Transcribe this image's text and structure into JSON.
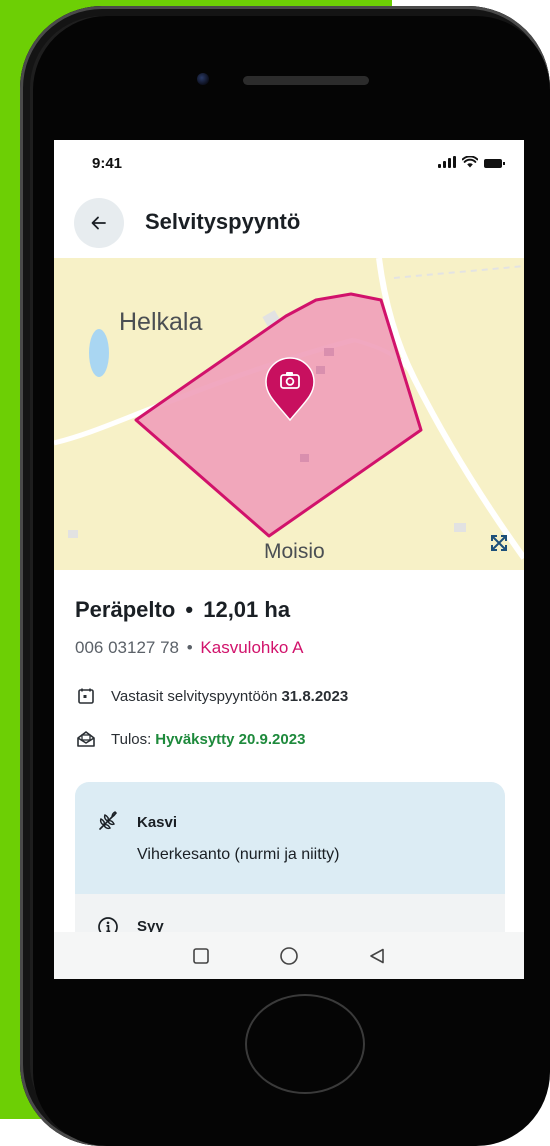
{
  "status_bar": {
    "time": "9:41"
  },
  "app_bar": {
    "title": "Selvityspyyntö",
    "back_icon": "arrow-left-icon"
  },
  "map": {
    "labels": {
      "place_1": "Helkala",
      "place_2": "Moisio"
    },
    "marker_icon": "camera-icon",
    "expand_icon": "expand-icon",
    "colors": {
      "land": "#f7f1c7",
      "parcel_fill": "#ef9fb9",
      "parcel_stroke": "#d1126b",
      "marker": "#c8105f",
      "water": "#a9d6f2"
    }
  },
  "field": {
    "name": "Peräpelto",
    "separator": "•",
    "area": "12,01 ha",
    "id": "006 03127 78",
    "block_link": "Kasvulohko A"
  },
  "response": {
    "text": "Vastasit selvityspyyntöön",
    "date": "31.8.2023",
    "icon": "calendar-icon"
  },
  "result": {
    "prefix": "Tulos:",
    "value": "Hyväksytty 20.9.2023",
    "icon": "inbox-icon"
  },
  "card": {
    "label": "Kasvi",
    "value": "Viherkesanto (nurmi ja niitty)",
    "icon": "wheat-icon"
  },
  "card2": {
    "label": "Syy",
    "icon": "info-icon"
  },
  "nav": {
    "recents_icon": "square-icon",
    "home_icon": "circle-icon",
    "back_icon": "triangle-back-icon"
  },
  "theme": {
    "accent": "#d1126b",
    "success": "#1e8a3c",
    "card_bg": "#dcecf4"
  }
}
